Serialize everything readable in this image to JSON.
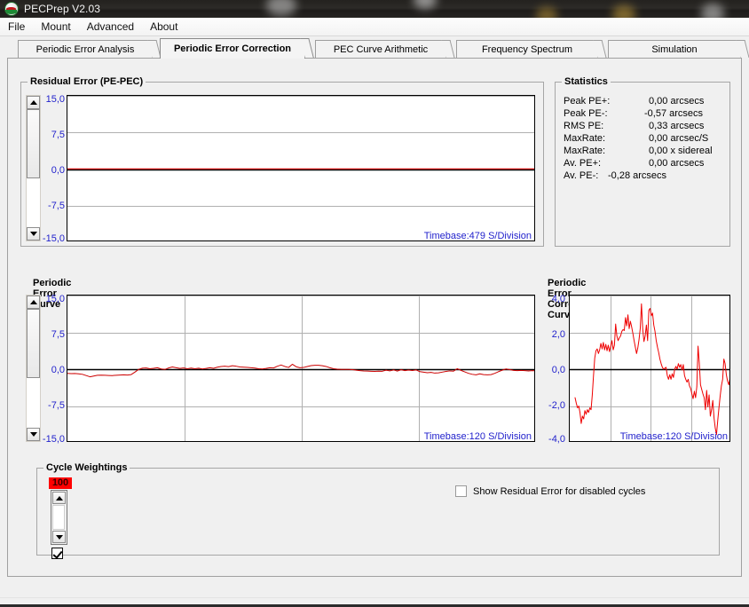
{
  "window": {
    "title": "PECPrep V2.03",
    "icon": "app-logo-icon"
  },
  "menu": {
    "items": [
      {
        "label": "File"
      },
      {
        "label": "Mount"
      },
      {
        "label": "Advanced"
      },
      {
        "label": "About"
      }
    ]
  },
  "tabs": [
    {
      "label": "Periodic Error Analysis",
      "active": false
    },
    {
      "label": "Periodic Error Correction",
      "active": true
    },
    {
      "label": "PEC Curve Arithmetic",
      "active": false
    },
    {
      "label": "Frequency Spectrum",
      "active": false
    },
    {
      "label": "Simulation",
      "active": false
    }
  ],
  "residual_group": {
    "title": "Residual Error (PE-PEC)"
  },
  "statistics": {
    "title": "Statistics",
    "rows": [
      {
        "label": "Peak PE+:",
        "value": "0,00 arcsecs"
      },
      {
        "label": "Peak PE-:",
        "value": "-0,57 arcsecs"
      },
      {
        "label": "RMS PE:",
        "value": "0,33 arcsecs"
      },
      {
        "label": "MaxRate:",
        "value": "0,00 arcsec/S"
      },
      {
        "label": "MaxRate:",
        "value": "0,00 x sidereal"
      },
      {
        "label": "Av. PE+:",
        "value": "0,00 arcsecs"
      },
      {
        "label": "Av. PE-:",
        "value": "-0,28 arcsecs"
      }
    ]
  },
  "cycle_weightings": {
    "title": "Cycle Weightings",
    "weight_value": "100",
    "weight_bg_color": "#ff0000",
    "cycle_enabled": true,
    "show_residual_checkbox": {
      "label": "Show Residual Error for disabled cycles",
      "checked": false
    }
  },
  "colors": {
    "curve": "#cc0000",
    "axis_text": "#2222cc",
    "grid": "#b0b0b0",
    "zero_line": "#000000",
    "plot_bg": "#ffffff",
    "window_bg": "#f0f0f0"
  },
  "chart_data": [
    {
      "id": "residual-error",
      "type": "line",
      "title": "Residual Error (PE-PEC)",
      "ylabel": "",
      "xlabel": "",
      "ylim": [
        -15.0,
        15.0
      ],
      "ytick_labels": [
        "15,0",
        "7,5",
        "0,0",
        "-7,5",
        "-15,0"
      ],
      "yticks": [
        15.0,
        7.5,
        0.0,
        -7.5,
        -15.0
      ],
      "grid": true,
      "annotation": "Timebase:479 S/Division",
      "timebase_seconds_per_division": 479,
      "series": [
        {
          "name": "Residual Error",
          "color": "#cc0000",
          "values": [
            0.02,
            0.02,
            0.02,
            0.02,
            0.02,
            0.02,
            0.02,
            0.02,
            0.02,
            0.02,
            0.02,
            0.02,
            0.02,
            0.02,
            0.02,
            0.02,
            0.02,
            0.02,
            0.02,
            0.02,
            0.02,
            0.02,
            0.02,
            0.02,
            0.02,
            0.02,
            0.02,
            0.02,
            0.02,
            0.02,
            0.02,
            0.02,
            0.02,
            0.02,
            0.02,
            0.02,
            0.02,
            0.02,
            0.02,
            0.02,
            0.02,
            0.02,
            0.02,
            0.02,
            0.02,
            0.02,
            0.02,
            0.02,
            0.02,
            0.02,
            0.02,
            0.02,
            0.02,
            0.02,
            0.02,
            0.02,
            0.02,
            0.02,
            0.02,
            0.02,
            0.02,
            0.02,
            0.02,
            0.02,
            0.02,
            0.02,
            0.02,
            0.02,
            0.02,
            0.02,
            0.02,
            0.02,
            0.02,
            0.02,
            0.02,
            0.02,
            0.02,
            0.02,
            0.02,
            0.02,
            0.02,
            0.02,
            0.02,
            0.02,
            0.02,
            0.02,
            0.02,
            0.02,
            0.02,
            0.02,
            0.02,
            0.02,
            0.02,
            0.02,
            0.02,
            0.02,
            0.02,
            0.02,
            0.02,
            0.02
          ]
        }
      ]
    },
    {
      "id": "periodic-error-curve",
      "type": "line",
      "title": "Periodic Error Curve",
      "ylabel": "",
      "xlabel": "",
      "ylim": [
        -15.0,
        15.0
      ],
      "ytick_labels": [
        "15,0",
        "7,5",
        "0,0",
        "-7,5",
        "-15,0"
      ],
      "yticks": [
        15.0,
        7.5,
        0.0,
        -7.5,
        -15.0
      ],
      "grid": true,
      "vertical_divisions": 4,
      "annotation": "Timebase:120 S/Division",
      "timebase_seconds_per_division": 120,
      "series": [
        {
          "name": "Periodic Error",
          "color": "#cc0000",
          "values": [
            -0.85,
            -0.9,
            -0.88,
            -0.95,
            -1.05,
            -1.3,
            -1.55,
            -1.4,
            -1.25,
            -1.22,
            -1.25,
            -1.28,
            -1.3,
            -1.25,
            -1.2,
            -1.15,
            -1.2,
            -1.1,
            -0.6,
            -0.05,
            0.2,
            0.25,
            0.1,
            0.18,
            0.3,
            0.05,
            -0.05,
            0.25,
            0.45,
            0.3,
            0.15,
            0.25,
            0.1,
            0.22,
            0.1,
            0.2,
            0.05,
            0.15,
            0.3,
            0.18,
            0.4,
            0.55,
            0.6,
            0.52,
            0.7,
            0.6,
            0.45,
            0.4,
            0.35,
            0.3,
            0.22,
            0.1,
            0.05,
            0.15,
            0.3,
            0.25,
            0.6,
            0.85,
            0.55,
            0.35,
            1.0,
            0.5,
            0.3,
            0.35,
            0.55,
            0.72,
            0.8,
            0.78,
            0.7,
            0.55,
            0.3,
            0.1,
            0.0,
            -0.05,
            -0.05,
            -0.05,
            -0.1,
            -0.2,
            -0.3,
            -0.35,
            -0.38,
            -0.42,
            -0.45,
            -0.4,
            -0.42,
            -0.2,
            -0.35,
            -0.15,
            -0.38,
            -0.12,
            -0.3,
            -0.18,
            -0.28,
            -0.15,
            -0.5,
            -0.6,
            -0.72,
            -0.65,
            -0.8,
            -0.75,
            -0.6,
            -0.45,
            -0.35,
            -0.4,
            0.1,
            -0.25,
            -0.55,
            -0.85,
            -1.05,
            -1.15,
            -0.95,
            -1.1,
            -1.15,
            -1.1,
            -0.85,
            -0.5,
            -0.2,
            0.05,
            -0.1,
            -0.25,
            -0.3,
            -0.25,
            -0.3,
            -0.35,
            -0.3,
            -0.32
          ]
        }
      ]
    },
    {
      "id": "periodic-error-correction-curve",
      "type": "line",
      "title": "Periodic Error Correction Curve",
      "ylabel": "",
      "xlabel": "",
      "ylim": [
        -4.0,
        4.0
      ],
      "ytick_labels": [
        "4,0",
        "2,0",
        "0,0",
        "-2,0",
        "-4,0"
      ],
      "yticks": [
        4.0,
        2.0,
        0.0,
        -2.0,
        -4.0
      ],
      "grid": true,
      "vertical_divisions": 4,
      "annotation": "Timebase:120 S/Division",
      "timebase_seconds_per_division": 120,
      "series": [
        {
          "name": "PEC Curve",
          "color": "#ee0000",
          "values": [
            -1.55,
            -1.85,
            -2.1,
            -2.0,
            -2.35,
            -2.95,
            -2.55,
            -2.7,
            -2.25,
            -2.45,
            -2.2,
            -2.35,
            -2.1,
            -2.2,
            -1.4,
            -0.35,
            0.6,
            1.0,
            1.1,
            0.85,
            1.05,
            1.4,
            1.1,
            1.45,
            1.05,
            1.35,
            1.0,
            1.3,
            0.95,
            1.25,
            1.55,
            1.05,
            1.3,
            2.45,
            1.8,
            1.55,
            1.7,
            1.8,
            2.05,
            2.15,
            2.1,
            2.8,
            2.35,
            2.95,
            2.2,
            2.6,
            2.3,
            1.95,
            1.55,
            1.2,
            0.85,
            1.15,
            1.6,
            2.2,
            3.55,
            2.2,
            1.5,
            1.8,
            2.4,
            1.55,
            3.2,
            3.3,
            2.9,
            3.05,
            2.4,
            2.05,
            1.55,
            1.2,
            0.9,
            0.55,
            0.3,
            0.1,
            0.0,
            0.05,
            0.1,
            -0.35,
            -0.55,
            -0.3,
            -0.55,
            -0.25,
            -0.45,
            0.0,
            0.15,
            0.0,
            0.3,
            0.1,
            0.25,
            -0.05,
            0.25,
            -0.35,
            -0.55,
            -0.7,
            -0.55,
            -0.9,
            -1.05,
            -1.35,
            -1.6,
            -1.2,
            -1.55,
            -0.95,
            1.25,
            0.35,
            -0.85,
            -1.1,
            -1.35,
            -1.55,
            -2.2,
            -1.15,
            -2.05,
            -1.4,
            -2.55,
            -2.2,
            -1.7,
            -2.65,
            -3.2,
            -3.55,
            -2.8,
            -2.1,
            -1.45,
            -0.9,
            -0.55,
            0.55,
            0.3,
            -0.3,
            -0.65,
            -0.85,
            -0.5,
            -0.75
          ]
        }
      ]
    }
  ]
}
